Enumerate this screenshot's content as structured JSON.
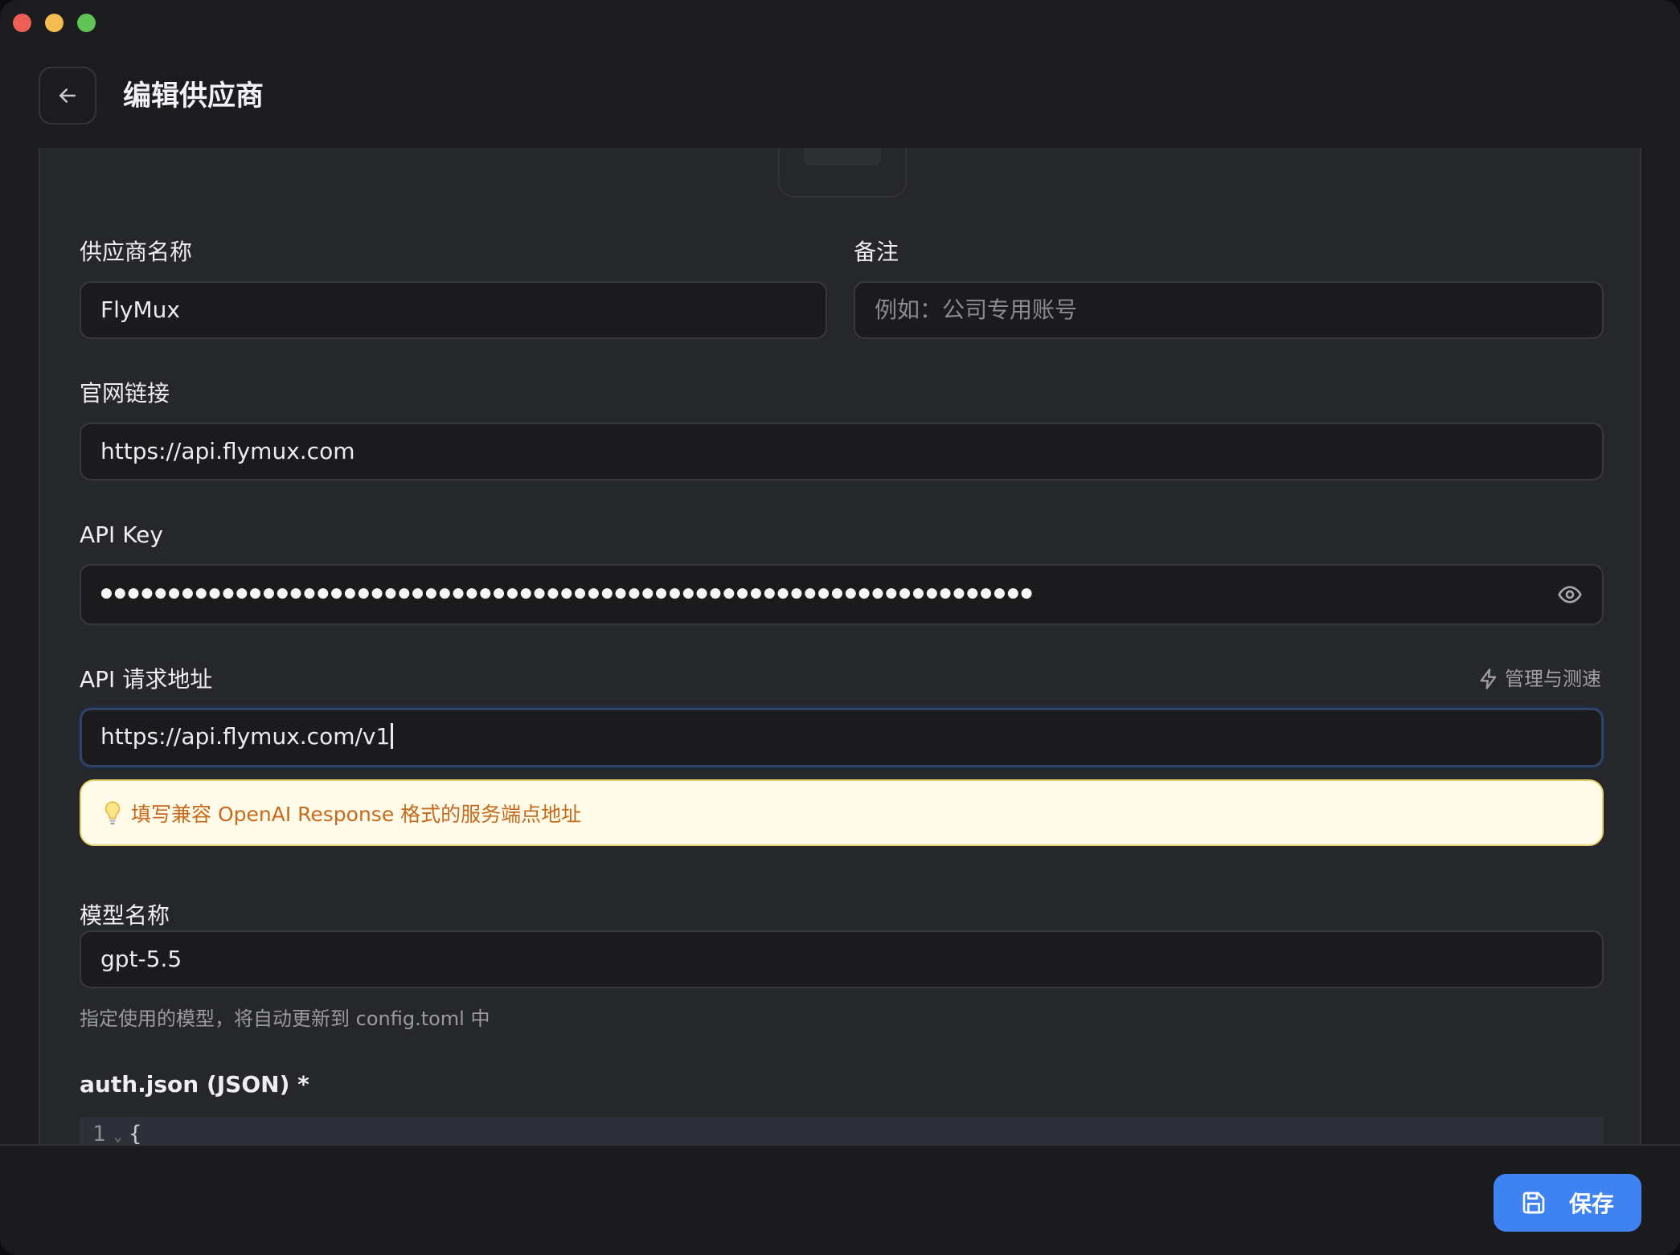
{
  "header": {
    "title": "编辑供应商"
  },
  "form": {
    "provider_name": {
      "label": "供应商名称",
      "value": "FlyMux"
    },
    "note": {
      "label": "备注",
      "placeholder": "例如：公司专用账号"
    },
    "website": {
      "label": "官网链接",
      "value": "https://api.flymux.com"
    },
    "api_key": {
      "label": "API Key",
      "masked_value": "●●●●●●●●●●●●●●●●●●●●●●●●●●●●●●●●●●●●●●●●●●●●●●●●●●●●●●●●●●●●●●●●●●●●●●●●●●●●●●●●●●●●●●●●●●●●●●●●●●●●●●●"
    },
    "api_url": {
      "label": "API 请求地址",
      "value": "https://api.flymux.com/v1",
      "manage_label": "管理与测速",
      "hint": "填写兼容 OpenAI Response 格式的服务端点地址"
    },
    "model": {
      "label": "模型名称",
      "value": "gpt-5.5",
      "help": "指定使用的模型，将自动更新到 config.toml 中"
    },
    "auth_json": {
      "label": "auth.json (JSON) *",
      "first_line_number": "1",
      "first_line_text": "{"
    }
  },
  "footer": {
    "save_label": "保存"
  },
  "colors": {
    "accent": "#3f82f2",
    "hint_bg": "#fefbe9",
    "hint_text": "#c76a1d"
  }
}
